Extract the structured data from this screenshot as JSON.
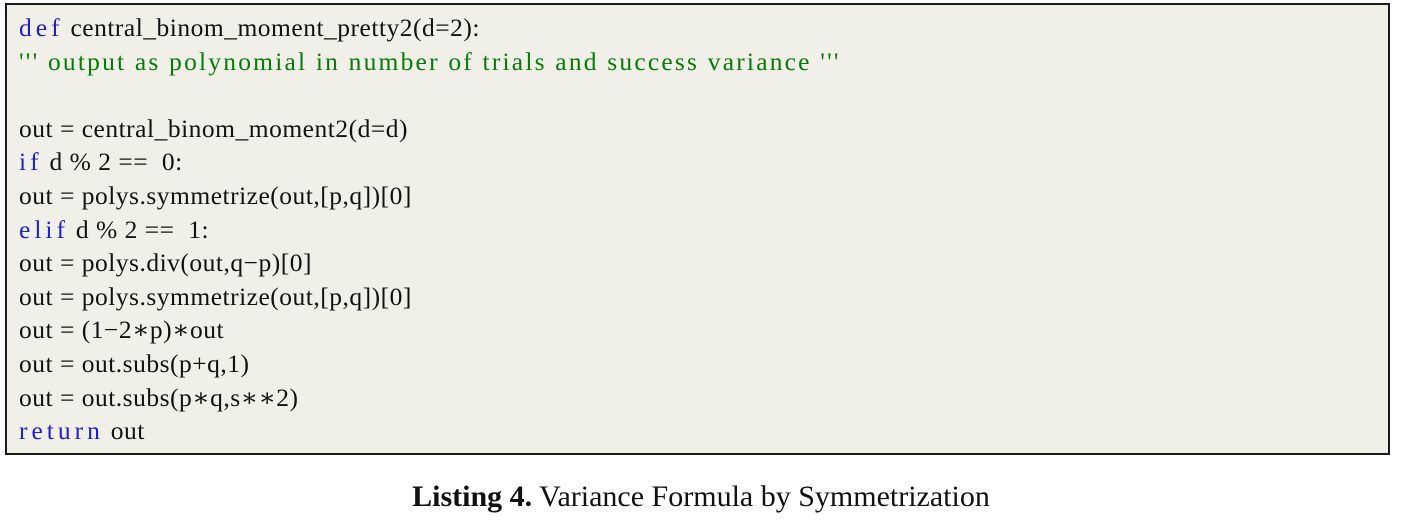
{
  "listing": {
    "language": "python",
    "background_color": "#f0f0e8",
    "border_color": "#1b1b1b",
    "keyword_color": "#1f1fcc",
    "string_color": "#077b07",
    "text_color": "#111111",
    "lines": [
      {
        "id": "line-1",
        "segments": [
          {
            "kind": "keyword",
            "text": "def"
          },
          {
            "kind": "plain",
            "text": " central_binom_moment_pretty2(d=2):"
          }
        ]
      },
      {
        "id": "line-2",
        "segments": [
          {
            "kind": "string",
            "text": "''' output as polynomial in number of trials and success variance '''"
          }
        ]
      },
      {
        "id": "line-3",
        "segments": [
          {
            "kind": "plain",
            "text": ""
          }
        ]
      },
      {
        "id": "line-4",
        "segments": [
          {
            "kind": "plain",
            "text": "out = central_binom_moment2(d=d)"
          }
        ]
      },
      {
        "id": "line-5",
        "segments": [
          {
            "kind": "keyword",
            "text": "if"
          },
          {
            "kind": "plain",
            "text": " d % 2 ==  0:"
          }
        ]
      },
      {
        "id": "line-6",
        "segments": [
          {
            "kind": "plain",
            "text": "out = polys.symmetrize(out,[p,q])[0]"
          }
        ]
      },
      {
        "id": "line-7",
        "segments": [
          {
            "kind": "keyword",
            "text": "elif"
          },
          {
            "kind": "plain",
            "text": " d % 2 ==  1:"
          }
        ]
      },
      {
        "id": "line-8",
        "segments": [
          {
            "kind": "plain",
            "text": "out = polys.div(out,q−p)[0]"
          }
        ]
      },
      {
        "id": "line-9",
        "segments": [
          {
            "kind": "plain",
            "text": "out = polys.symmetrize(out,[p,q])[0]"
          }
        ]
      },
      {
        "id": "line-10",
        "segments": [
          {
            "kind": "plain",
            "text": "out = (1−2∗p)∗out"
          }
        ]
      },
      {
        "id": "line-11",
        "segments": [
          {
            "kind": "plain",
            "text": "out = out.subs(p+q,1)"
          }
        ]
      },
      {
        "id": "line-12",
        "segments": [
          {
            "kind": "plain",
            "text": "out = out.subs(p∗q,s∗∗2)"
          }
        ]
      },
      {
        "id": "line-13",
        "segments": [
          {
            "kind": "keyword",
            "text": "return"
          },
          {
            "kind": "plain",
            "text": " out"
          }
        ]
      }
    ]
  },
  "caption": {
    "label": "Listing 4.",
    "text": " Variance Formula by Symmetrization"
  }
}
